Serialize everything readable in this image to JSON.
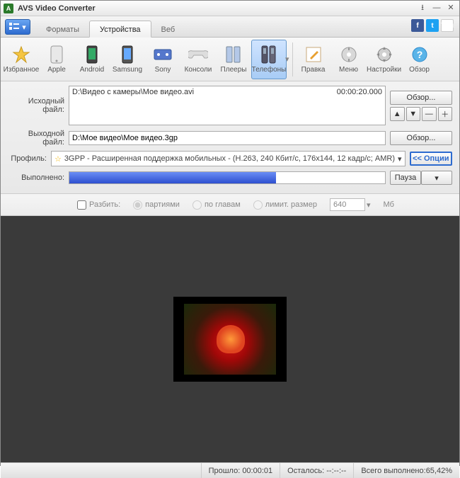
{
  "title": "AVS Video Converter",
  "tabs": {
    "formats": "Форматы",
    "devices": "Устройства",
    "web": "Веб"
  },
  "toolbar": {
    "favorites": "Избранное",
    "apple": "Apple",
    "android": "Android",
    "samsung": "Samsung",
    "sony": "Sony",
    "consoles": "Консоли",
    "players": "Плееры",
    "phones": "Телефоны",
    "edit": "Правка",
    "menu": "Меню",
    "settings": "Настройки",
    "about": "Обзор"
  },
  "labels": {
    "source": "Исходный файл:",
    "output": "Выходной файл:",
    "profile": "Профиль:",
    "progress": "Выполнено:",
    "split": "Разбить:",
    "byparts": "партиями",
    "bychapters": "по главам",
    "bysize": "лимит. размер",
    "mb": "Мб"
  },
  "files": {
    "source_path": "D:\\Видео с камеры\\Мое видео.avi",
    "source_duration": "00:00:20.000",
    "output_path": "D:\\Мое видео\\Мое видео.3gp"
  },
  "profile": "3GPP - Расширенная поддержка мобильных - (H.263, 240 Кбит/с, 176x144, 12 кадр/с; AMR)",
  "buttons": {
    "browse": "Обзор...",
    "options": "<< Опции",
    "pause": "Пауза"
  },
  "split_size": "640",
  "status": {
    "elapsed_label": "Прошло:",
    "elapsed": "00:00:01",
    "left_label": "Осталось:",
    "left": "--:--:--",
    "overall_label": "Всего выполнено:",
    "overall": "65,42%"
  },
  "progress_pct": 65.42
}
